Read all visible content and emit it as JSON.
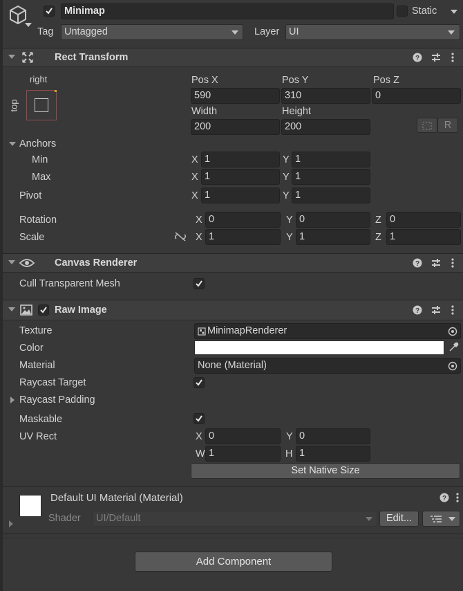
{
  "object": {
    "active": true,
    "name": "Minimap",
    "static_label": "Static",
    "static_checked": false,
    "tag_label": "Tag",
    "tag_value": "Untagged",
    "layer_label": "Layer",
    "layer_value": "UI"
  },
  "rect_transform": {
    "title": "Rect Transform",
    "anchor_preset_right": "right",
    "anchor_preset_top": "top",
    "pos_x_label": "Pos X",
    "pos_x": "590",
    "pos_y_label": "Pos Y",
    "pos_y": "310",
    "pos_z_label": "Pos Z",
    "pos_z": "0",
    "width_label": "Width",
    "width": "200",
    "height_label": "Height",
    "height": "200",
    "raw_edit_label": "R",
    "anchors_label": "Anchors",
    "min_label": "Min",
    "min_x": "1",
    "min_y": "1",
    "max_label": "Max",
    "max_x": "1",
    "max_y": "1",
    "pivot_label": "Pivot",
    "pivot_x": "1",
    "pivot_y": "1",
    "rotation_label": "Rotation",
    "rot_x": "0",
    "rot_y": "0",
    "rot_z": "0",
    "scale_label": "Scale",
    "scale_x": "1",
    "scale_y": "1",
    "scale_z": "1",
    "x": "X",
    "y": "Y",
    "z": "Z"
  },
  "canvas_renderer": {
    "title": "Canvas Renderer",
    "cull_label": "Cull Transparent Mesh",
    "cull_checked": true
  },
  "raw_image": {
    "title": "Raw Image",
    "enabled": true,
    "texture_label": "Texture",
    "texture_value": "MinimapRenderer",
    "color_label": "Color",
    "color_value": "#ffffff",
    "material_label": "Material",
    "material_value": "None (Material)",
    "raycast_target_label": "Raycast Target",
    "raycast_target_checked": true,
    "raycast_padding_label": "Raycast Padding",
    "maskable_label": "Maskable",
    "maskable_checked": true,
    "uv_rect_label": "UV Rect",
    "uv_x": "0",
    "uv_y": "0",
    "uv_w": "1",
    "uv_h": "1",
    "x": "X",
    "y": "Y",
    "w": "W",
    "h": "H",
    "native_size_button": "Set Native Size"
  },
  "material_preview": {
    "title": "Default UI Material (Material)",
    "shader_label": "Shader",
    "shader_value": "UI/Default",
    "edit_button": "Edit..."
  },
  "add_component_button": "Add Component",
  "colors": {
    "background": "#383838",
    "field": "#2a2a2a",
    "header": "#3e3e3e",
    "button": "#585858"
  }
}
